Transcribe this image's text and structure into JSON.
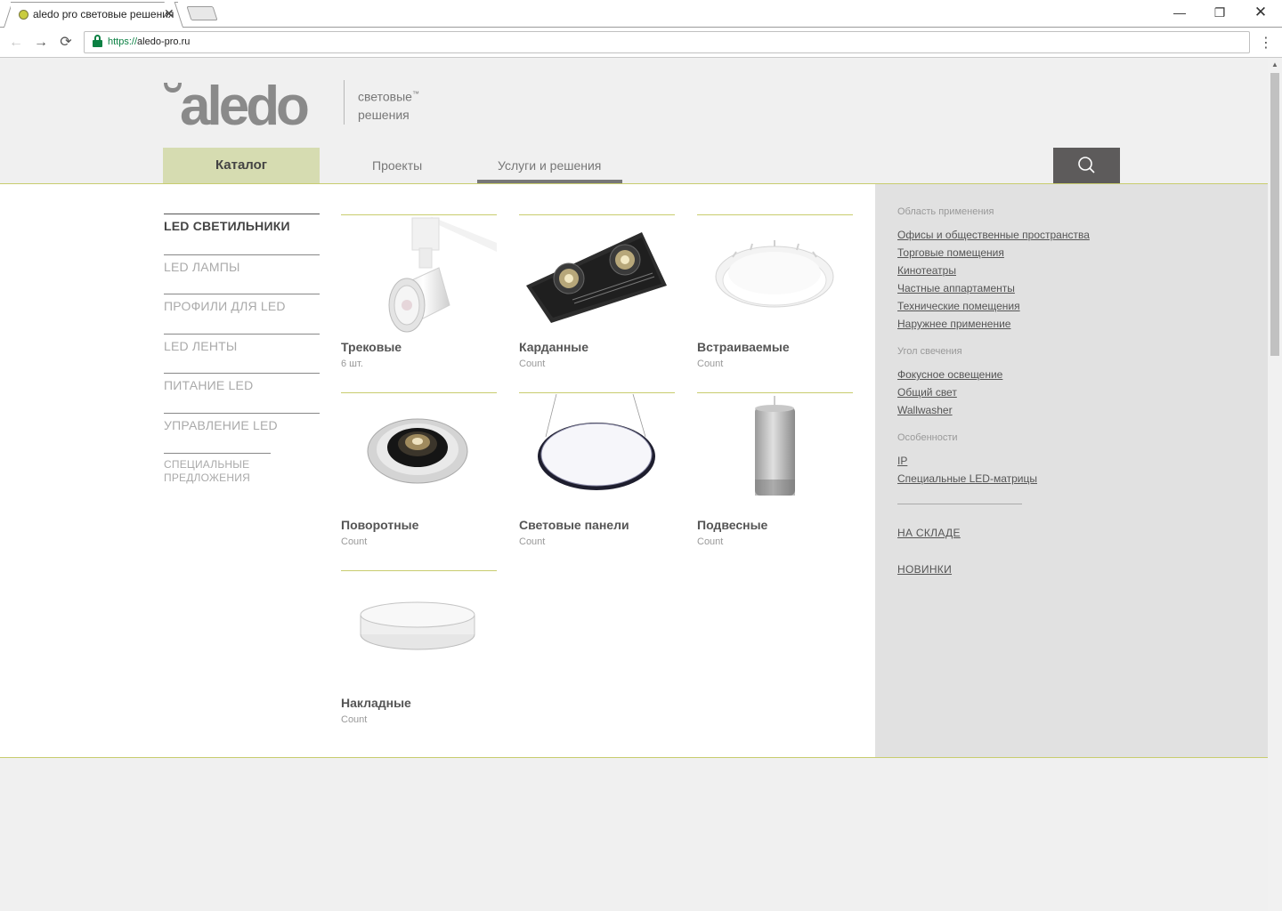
{
  "browser": {
    "tab_title": "aledo pro световые решения",
    "tab_close": "✕",
    "url_scheme": "https://",
    "url_host": "aledo-pro.ru",
    "win_minimize": "—",
    "win_restore": "❐",
    "win_close": "✕",
    "back": "←",
    "forward": "→",
    "reload": "⟳",
    "menu": "⋮"
  },
  "header": {
    "logo_text": "aledo",
    "tagline_line1": "световые",
    "tagline_tm": "™",
    "tagline_line2": "решения",
    "nav": {
      "catalog": "Каталог",
      "projects": "Проекты",
      "services": "Услуги и решения"
    }
  },
  "sidebar": {
    "items": [
      {
        "label": "LED СВЕТИЛЬНИКИ"
      },
      {
        "label": "LED ЛАМПЫ"
      },
      {
        "label": "ПРОФИЛИ ДЛЯ LED"
      },
      {
        "label": "LED ЛЕНТЫ"
      },
      {
        "label": "ПИТАНИЕ LED"
      },
      {
        "label": "УПРАВЛЕНИЕ LED"
      },
      {
        "label": "СПЕЦИАЛЬНЫЕ ПРЕДЛОЖЕНИЯ"
      }
    ]
  },
  "products": [
    {
      "name": "Трековые",
      "count": "6 шт."
    },
    {
      "name": "Карданные",
      "count": "Count"
    },
    {
      "name": "Встраиваемые",
      "count": "Count"
    },
    {
      "name": "Поворотные",
      "count": "Count"
    },
    {
      "name": "Световые панели",
      "count": "Count"
    },
    {
      "name": "Подвесные",
      "count": "Count"
    },
    {
      "name": "Накладные",
      "count": "Count"
    }
  ],
  "filters": {
    "application": {
      "heading": "Область применения",
      "links": [
        "Офисы и общественные пространства",
        "Торговые помещения",
        "Кинотеатры",
        "Частные аппартаменты",
        "Технические помещения",
        "Наружнее применение"
      ]
    },
    "angle": {
      "heading": "Угол свечения",
      "links": [
        "Фокусное освещение",
        "Общий свет",
        "Wallwasher"
      ]
    },
    "features": {
      "heading": "Особенности",
      "links": [
        "IP",
        "Специальные LED-матрицы"
      ]
    },
    "in_stock": "НА СКЛАДЕ",
    "new": "НОВИНКИ"
  },
  "colors": {
    "accent_line": "#c8cc6e",
    "catalog_bg": "#d6dcb1",
    "search_bg": "#5d5b5b",
    "favicon": "#c9cc3f"
  }
}
